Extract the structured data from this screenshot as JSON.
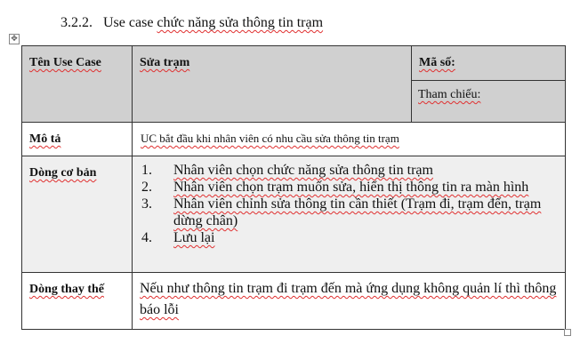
{
  "heading": {
    "number": "3.2.2.",
    "prefix": "Use case",
    "title_vi": "chức năng sửa thông tin trạm"
  },
  "table": {
    "name_label": "Tên Use Case",
    "name_value": "Sửa trạm",
    "code_label": "Mã số:",
    "reference_label": "Tham chiếu:",
    "description_label": "Mô tả",
    "description_value": "UC bắt đầu khi nhân viên có nhu cầu sửa thông tin trạm",
    "basic_flow_label": "Dòng cơ bản",
    "basic_flow_steps": [
      {
        "n": "1.",
        "text": "Nhân viên chọn chức năng sửa thông tin trạm"
      },
      {
        "n": "2.",
        "text": "Nhân viên chọn trạm muốn sửa, hiển thị thông tin ra màn hình"
      },
      {
        "n": "3.",
        "text": "Nhân viên chỉnh sửa thông tin cần thiết (Trạm đi, trạm đến, trạm dừng chân)"
      },
      {
        "n": "4.",
        "text": "Lưu lại"
      }
    ],
    "alt_flow_label": "Dòng thay thế",
    "alt_flow_value": "Nếu như thông tin trạm đi trạm đến mà ứng dụng không quản lí thì thông báo lỗi"
  }
}
